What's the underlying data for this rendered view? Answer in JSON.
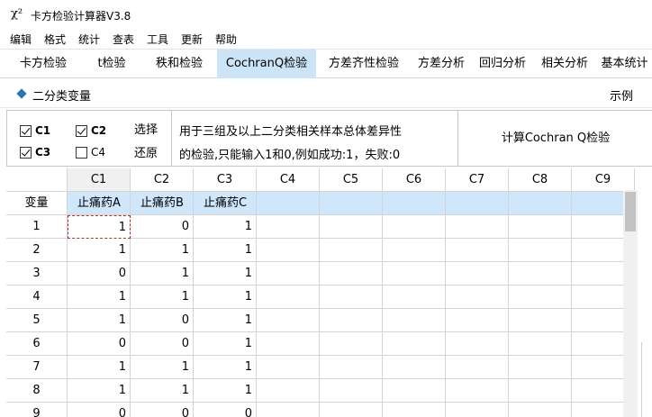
{
  "window": {
    "icon_glyph": "χ²",
    "title": "卡方检验计算器V3.8"
  },
  "menu": [
    "编辑",
    "格式",
    "统计",
    "查表",
    "工具",
    "更新",
    "帮助"
  ],
  "tabs": [
    {
      "label": "卡方检验",
      "active": false
    },
    {
      "label": "t检验",
      "active": false
    },
    {
      "label": "秩和检验",
      "active": false
    },
    {
      "label": "CochranQ检验",
      "active": true
    },
    {
      "label": "方差齐性检验",
      "active": false
    },
    {
      "label": "方差分析",
      "active": false
    },
    {
      "label": "回归分析",
      "active": false
    },
    {
      "label": "相关分析",
      "active": false
    },
    {
      "label": "基本统计",
      "active": false
    }
  ],
  "section": {
    "title": "二分类变量",
    "example_label": "示例"
  },
  "options": {
    "checkboxes": [
      {
        "label": "C1",
        "checked": true
      },
      {
        "label": "C2",
        "checked": true
      },
      {
        "label": "C3",
        "checked": true
      },
      {
        "label": "C4",
        "checked": false
      }
    ],
    "select_label": "选择",
    "restore_label": "还原",
    "description_line1": "用于三组及以上二分类相关样本总体差异性",
    "description_line2": "的检验,只能输入1和0,例如成功:1，失败:0",
    "calculate_label": "计算Cochran Q检验"
  },
  "grid": {
    "columns": [
      "C1",
      "C2",
      "C3",
      "C4",
      "C5",
      "C6",
      "C7",
      "C8",
      "C9"
    ],
    "name_row_label": "变量",
    "variable_names": [
      "止痛药A",
      "止痛药B",
      "止痛药C",
      "",
      "",
      "",
      "",
      "",
      ""
    ],
    "rows": [
      {
        "n": "1",
        "values": [
          "1",
          "0",
          "1"
        ]
      },
      {
        "n": "2",
        "values": [
          "1",
          "1",
          "1"
        ]
      },
      {
        "n": "3",
        "values": [
          "0",
          "1",
          "1"
        ]
      },
      {
        "n": "4",
        "values": [
          "1",
          "1",
          "1"
        ]
      },
      {
        "n": "5",
        "values": [
          "1",
          "0",
          "1"
        ]
      },
      {
        "n": "6",
        "values": [
          "0",
          "0",
          "1"
        ]
      },
      {
        "n": "7",
        "values": [
          "1",
          "1",
          "1"
        ]
      },
      {
        "n": "8",
        "values": [
          "1",
          "1",
          "1"
        ]
      },
      {
        "n": "9",
        "values": [
          "0",
          "0",
          "0"
        ]
      }
    ]
  }
}
